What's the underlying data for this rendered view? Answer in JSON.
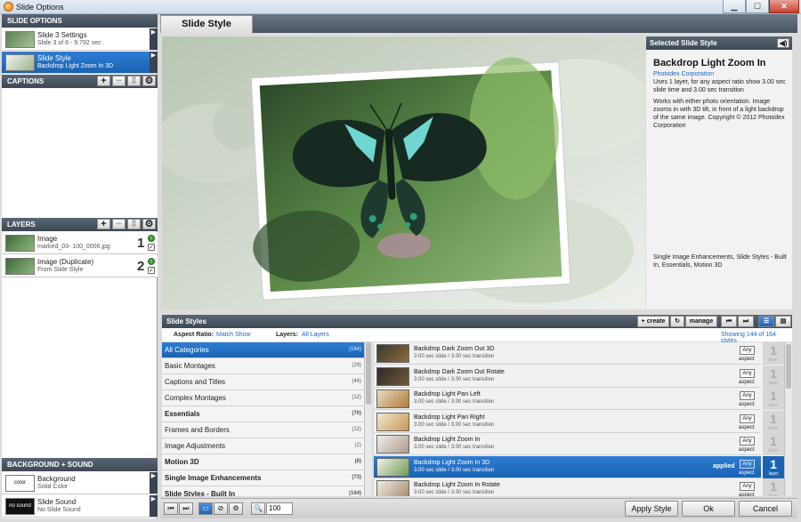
{
  "window": {
    "title": "Slide Options"
  },
  "left": {
    "slide_options_header": "SLIDE OPTIONS",
    "slide_items": [
      {
        "title": "Slide 3 Settings",
        "subtitle": "Slide 3 of 6 - 9.792 sec"
      },
      {
        "title": "Slide Style",
        "subtitle": "Backdrop Light Zoom In 3D"
      }
    ],
    "captions_header": "CAPTIONS",
    "layers_header": "LAYERS",
    "layers": [
      {
        "title": "Image",
        "subtitle": "marked_03- 100_0006.jpg",
        "number": "1"
      },
      {
        "title": "Image (Duplicate)",
        "subtitle": "From Slide Style",
        "number": "2"
      }
    ],
    "bg_sound_header": "BACKGROUND + SOUND",
    "bg_items": [
      {
        "thumb": "color",
        "title": "Background",
        "subtitle": "Solid Color"
      },
      {
        "thumb": "no sound",
        "title": "Slide Sound",
        "subtitle": "No Slide Sound"
      }
    ]
  },
  "tab": {
    "label": "Slide Style"
  },
  "selected_style": {
    "header": "Selected Slide Style",
    "title": "Backdrop Light Zoom In",
    "author": "Photodex Corporation",
    "desc1": "Uses 1 layer, for any aspect ratio show 3.00 sec slide time and 3.00 sec transition",
    "desc2": "Works with either photo orientation. Image zooms in with 3D tilt, in front of a light backdrop of the same image. Copyright © 2012 Photodex Corporation",
    "categories": "Single Image Enhancements, Slide Styles - Built In, Essentials, Motion 3D"
  },
  "styles": {
    "header": "Slide Styles",
    "create_label": "create",
    "manage_label": "manage",
    "aspect_label": "Aspect Ratio:",
    "aspect_value": "Match Show",
    "layers_label": "Layers:",
    "layers_value": "All Layers",
    "showing": "Showing 144 of 164 styles",
    "categories": [
      {
        "name": "All Categories",
        "count": "(164)",
        "bold": false,
        "selected": true
      },
      {
        "name": "Basic Montages",
        "count": "(29)",
        "bold": false,
        "selected": false
      },
      {
        "name": "Captions and Titles",
        "count": "(44)",
        "bold": false,
        "selected": false
      },
      {
        "name": "Complex Montages",
        "count": "(12)",
        "bold": false,
        "selected": false
      },
      {
        "name": "Essentials",
        "count": "(76)",
        "bold": true,
        "selected": false
      },
      {
        "name": "Frames and Borders",
        "count": "(12)",
        "bold": false,
        "selected": false
      },
      {
        "name": "Image Adjustments",
        "count": "(2)",
        "bold": false,
        "selected": false
      },
      {
        "name": "Motion 3D",
        "count": "(8)",
        "bold": true,
        "selected": false
      },
      {
        "name": "Single Image Enhancements",
        "count": "(73)",
        "bold": true,
        "selected": false
      },
      {
        "name": "Slide Styles - Built In",
        "count": "(164)",
        "bold": true,
        "selected": false
      }
    ],
    "items": [
      {
        "name": "Backdrop Dark Zoom Out 3D",
        "timing": "3.00 sec slide / 3.00 sec transition",
        "aspect": "Any",
        "aspect_label": "aspect",
        "layers": "1",
        "layer_label": "layer",
        "selected": false,
        "applied": ""
      },
      {
        "name": "Backdrop Dark Zoom Out Rotate",
        "timing": "3.00 sec slide / 3.00 sec transition",
        "aspect": "Any",
        "aspect_label": "aspect",
        "layers": "1",
        "layer_label": "layer",
        "selected": false,
        "applied": ""
      },
      {
        "name": "Backdrop Light Pan Left",
        "timing": "3.00 sec slide / 3.00 sec transition",
        "aspect": "Any",
        "aspect_label": "aspect",
        "layers": "1",
        "layer_label": "layer",
        "selected": false,
        "applied": ""
      },
      {
        "name": "Backdrop Light Pan Right",
        "timing": "3.00 sec slide / 3.00 sec transition",
        "aspect": "Any",
        "aspect_label": "aspect",
        "layers": "1",
        "layer_label": "layer",
        "selected": false,
        "applied": ""
      },
      {
        "name": "Backdrop Light Zoom In",
        "timing": "3.00 sec slide / 3.00 sec transition",
        "aspect": "Any",
        "aspect_label": "aspect",
        "layers": "1",
        "layer_label": "layer",
        "selected": false,
        "applied": ""
      },
      {
        "name": "Backdrop Light Zoom In 3D",
        "timing": "3.00 sec slide / 3.00 sec transition",
        "aspect": "Any",
        "aspect_label": "aspect",
        "layers": "1",
        "layer_label": "layer",
        "selected": true,
        "applied": "applied"
      },
      {
        "name": "Backdrop Light Zoom In Rotate",
        "timing": "3.00 sec slide / 3.00 sec transition",
        "aspect": "Any",
        "aspect_label": "aspect",
        "layers": "1",
        "layer_label": "layer",
        "selected": false,
        "applied": ""
      }
    ]
  },
  "bottom": {
    "zoom_value": "100",
    "apply_label": "Apply Style",
    "ok_label": "Ok",
    "cancel_label": "Cancel"
  },
  "colors": {
    "selection_blue": "#1a63b3",
    "header_dark": "#3e4855",
    "butterfly_cyan": "#6fd6d0"
  }
}
